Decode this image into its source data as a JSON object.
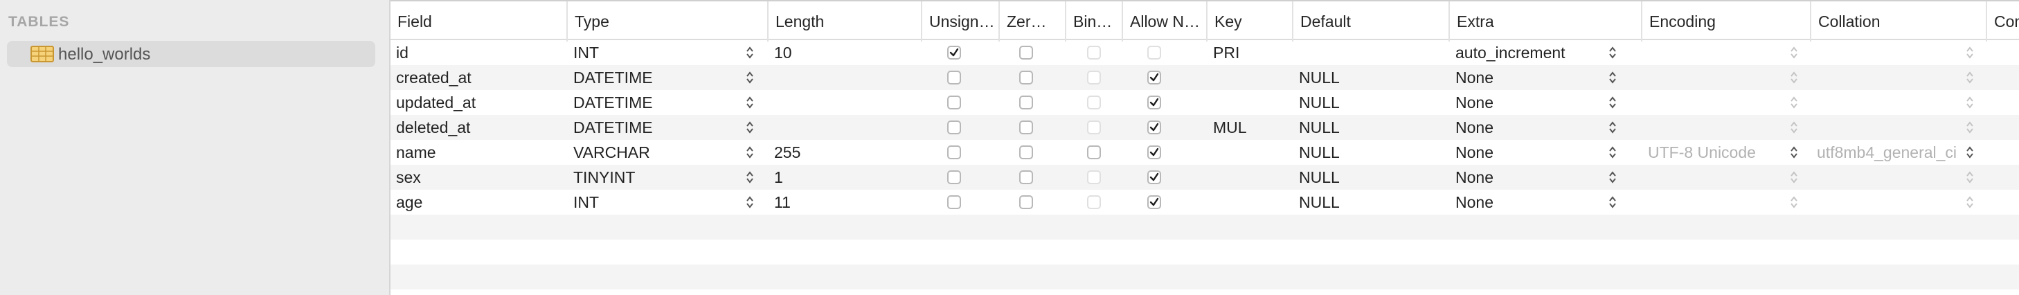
{
  "sidebar": {
    "heading": "TABLES",
    "tables": [
      {
        "label": "hello_worlds",
        "icon": "table-grid-icon"
      }
    ]
  },
  "columns": {
    "field": "Field",
    "type": "Type",
    "length": "Length",
    "unsigned": "Unsign…",
    "zerofill": "Zer…",
    "binary": "Bin…",
    "allow_null": "Allow N…",
    "key": "Key",
    "default": "Default",
    "extra": "Extra",
    "encoding": "Encoding",
    "collation": "Collation",
    "comment": "Com"
  },
  "rows": [
    {
      "field": "id",
      "type": "INT",
      "length": "10",
      "unsigned": true,
      "zerofill": false,
      "binary": false,
      "allow_null": false,
      "key": "PRI",
      "default": "",
      "extra": "auto_increment",
      "encoding": "",
      "collation": ""
    },
    {
      "field": "created_at",
      "type": "DATETIME",
      "length": "",
      "unsigned": false,
      "zerofill": false,
      "binary": false,
      "allow_null": true,
      "key": "",
      "default": "NULL",
      "extra": "None",
      "encoding": "",
      "collation": ""
    },
    {
      "field": "updated_at",
      "type": "DATETIME",
      "length": "",
      "unsigned": false,
      "zerofill": false,
      "binary": false,
      "allow_null": true,
      "key": "",
      "default": "NULL",
      "extra": "None",
      "encoding": "",
      "collation": ""
    },
    {
      "field": "deleted_at",
      "type": "DATETIME",
      "length": "",
      "unsigned": false,
      "zerofill": false,
      "binary": false,
      "allow_null": true,
      "key": "MUL",
      "default": "NULL",
      "extra": "None",
      "encoding": "",
      "collation": ""
    },
    {
      "field": "name",
      "type": "VARCHAR",
      "length": "255",
      "unsigned": false,
      "zerofill": false,
      "binary": false,
      "allow_null": true,
      "key": "",
      "default": "NULL",
      "extra": "None",
      "encoding": "UTF-8 Unicode",
      "collation": "utf8mb4_general_ci"
    },
    {
      "field": "sex",
      "type": "TINYINT",
      "length": "1",
      "unsigned": false,
      "zerofill": false,
      "binary": false,
      "allow_null": true,
      "key": "",
      "default": "NULL",
      "extra": "None",
      "encoding": "",
      "collation": ""
    },
    {
      "field": "age",
      "type": "INT",
      "length": "11",
      "unsigned": false,
      "zerofill": false,
      "binary": false,
      "allow_null": true,
      "key": "",
      "default": "NULL",
      "extra": "None",
      "encoding": "",
      "collation": ""
    }
  ],
  "empty_rows": 3
}
